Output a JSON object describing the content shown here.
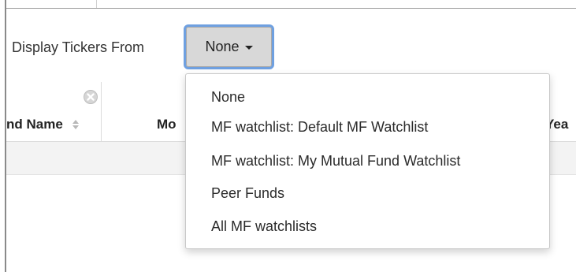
{
  "toolbar": {
    "display_label": "Display Tickers From",
    "select_value": "None"
  },
  "table": {
    "columns": {
      "fund_name": "nd Name",
      "morningstar": "Mo",
      "year": "Yea"
    }
  },
  "dropdown": {
    "options": [
      "None",
      "MF watchlist: Default MF Watchlist",
      "MF watchlist: My Mutual Fund Watchlist",
      "Peer Funds",
      "All MF watchlists"
    ],
    "selected": "None"
  },
  "colors": {
    "focus_ring": "#6fa0e0",
    "button_bg": "#d8d8d8",
    "band_bg": "#f3f3f3"
  },
  "icons": {
    "remove_column": "circle-x-icon",
    "sort": "sort-arrows-icon",
    "caret": "caret-down-icon"
  }
}
